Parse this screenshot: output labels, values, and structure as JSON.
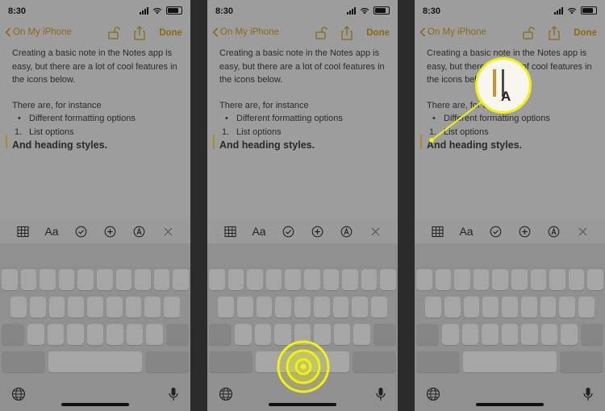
{
  "status": {
    "time": "8:30"
  },
  "nav": {
    "back_label": "On My iPhone",
    "done_label": "Done"
  },
  "note": {
    "intro": "Creating a basic note in the Notes app is easy, but there are a lot of cool features in the icons below.",
    "lead": "There are, for instance",
    "bullet_item": "Different formatting options",
    "numbered_marker": "1.",
    "numbered_item": "List options",
    "heading": "And heading styles."
  },
  "toolbar": {
    "format_label": "Aa"
  },
  "magnifier": {
    "label": "A"
  },
  "colors": {
    "accent": "#8a6a14",
    "highlight": "#f2f20a",
    "screen": "#9d9d9d"
  },
  "icons": [
    "chevron-left-icon",
    "lock-icon",
    "share-icon",
    "table-icon",
    "checklist-icon",
    "add-icon",
    "markup-icon",
    "close-icon",
    "globe-icon",
    "microphone-icon",
    "wifi-icon",
    "battery-icon"
  ]
}
